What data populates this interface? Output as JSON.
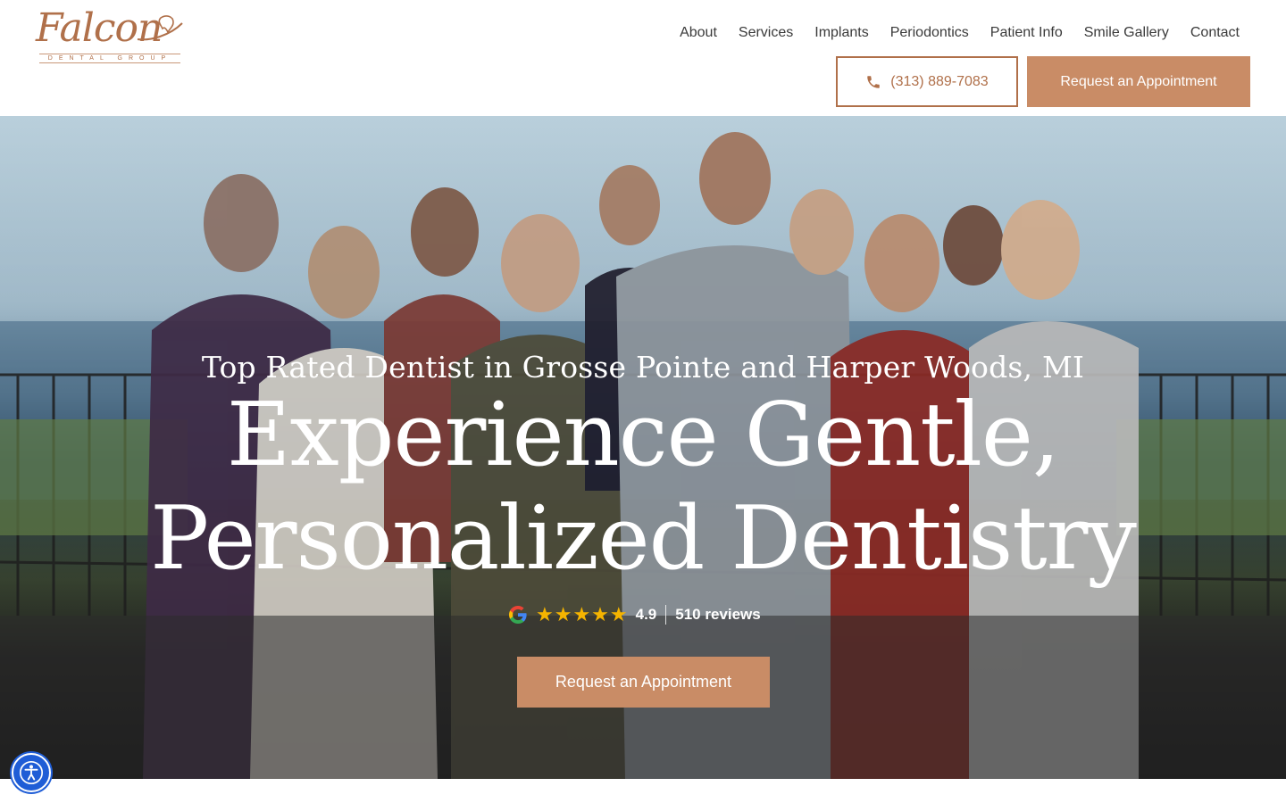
{
  "brand": {
    "name": "Falcon",
    "tagline": "DENTAL GROUP",
    "accent_color": "#c98c66",
    "logo_color": "#b0704a"
  },
  "nav": {
    "items": [
      {
        "label": "About"
      },
      {
        "label": "Services"
      },
      {
        "label": "Implants"
      },
      {
        "label": "Periodontics"
      },
      {
        "label": "Patient Info"
      },
      {
        "label": "Smile Gallery"
      },
      {
        "label": "Contact"
      }
    ]
  },
  "header": {
    "phone_label": "(313) 889-7083",
    "phone_icon": "phone-icon",
    "appointment_label": "Request an Appointment"
  },
  "hero": {
    "eyebrow": "Top Rated Dentist in Grosse Pointe and Harper Woods, MI",
    "title_line1": "Experience Gentle,",
    "title_line2": "Personalized Dentistry",
    "rating": {
      "source_icon": "google-icon",
      "stars": "★★★★★",
      "score": "4.9",
      "reviews": "510 reviews"
    },
    "cta_label": "Request an Appointment"
  },
  "accessibility": {
    "icon": "accessibility-icon"
  }
}
